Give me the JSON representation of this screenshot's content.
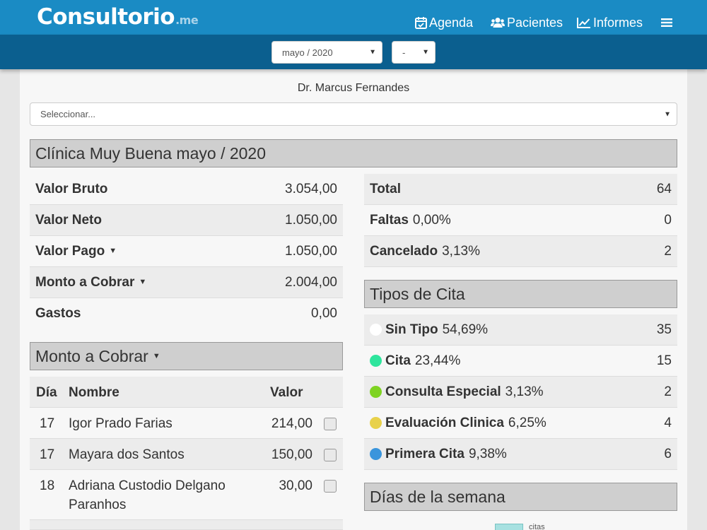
{
  "app": {
    "logo_main": "Consultorio",
    "logo_suffix": ".me"
  },
  "nav": {
    "agenda": "Agenda",
    "pacientes": "Pacientes",
    "informes": "Informes"
  },
  "filters": {
    "month": "mayo / 2020",
    "secondary": "-"
  },
  "doctor": "Dr. Marcus Fernandes",
  "professional_select": "Seleccionar...",
  "clinic_title": "Clínica Muy Buena mayo / 2020",
  "finance": [
    {
      "label": "Valor Bruto",
      "value": "3.054,00"
    },
    {
      "label": "Valor Neto",
      "value": "1.050,00"
    },
    {
      "label": "Valor Pago",
      "value": "1.050,00"
    },
    {
      "label": "Monto a Cobrar",
      "value": "2.004,00"
    },
    {
      "label": "Gastos",
      "value": "0,00"
    }
  ],
  "totals": [
    {
      "label": "Total",
      "pct": "",
      "value": "64"
    },
    {
      "label": "Faltas",
      "pct": "0,00%",
      "value": "0"
    },
    {
      "label": "Cancelado",
      "pct": "3,13%",
      "value": "2"
    }
  ],
  "monto_section": {
    "title": "Monto a Cobrar"
  },
  "receivables": {
    "columns": {
      "day": "Día",
      "name": "Nombre",
      "value": "Valor"
    },
    "rows": [
      {
        "day": "17",
        "name": "Igor Prado Farias",
        "name2": "",
        "value": "214,00"
      },
      {
        "day": "17",
        "name": "Mayara dos Santos",
        "name2": "",
        "value": "150,00"
      },
      {
        "day": "18",
        "name": "Adriana Custodio Delgano",
        "name2": "Paranhos",
        "value": "30,00"
      }
    ]
  },
  "tipos_section": {
    "title": "Tipos de Cita"
  },
  "appointment_types": [
    {
      "label": "Sin Tipo",
      "pct": "54,69%",
      "value": "35",
      "color": "#ffffff"
    },
    {
      "label": "Cita",
      "pct": "23,44%",
      "value": "15",
      "color": "#2ee59d"
    },
    {
      "label": "Consulta Especial",
      "pct": "3,13%",
      "value": "2",
      "color": "#7ed321"
    },
    {
      "label": "Evaluación Clinica",
      "pct": "6,25%",
      "value": "4",
      "color": "#e8d14a"
    },
    {
      "label": "Primera Cita",
      "pct": "9,38%",
      "value": "6",
      "color": "#3a95dc"
    }
  ],
  "dias_section": {
    "title": "Días de la semana",
    "legend": "citas"
  },
  "colors": {
    "header": "#1a8bc4",
    "subheader": "#0b5f8f"
  }
}
